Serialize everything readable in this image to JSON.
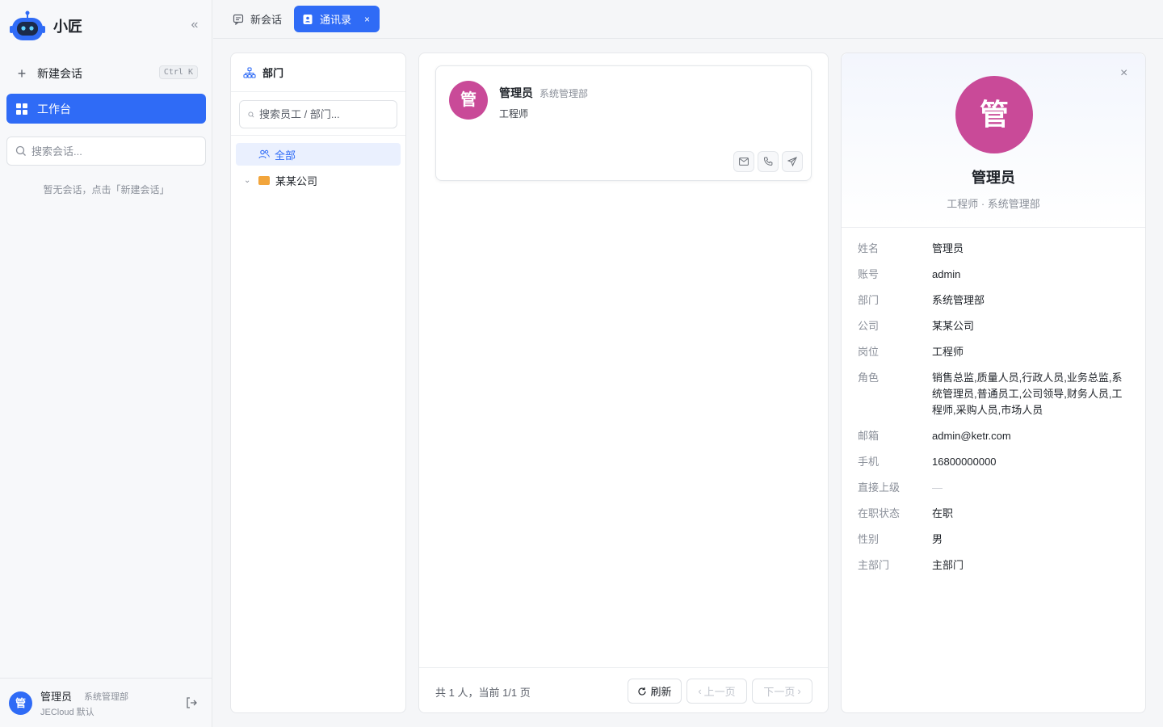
{
  "sidebar": {
    "brand": "小匠",
    "new_chat_label": "新建会话",
    "new_chat_shortcut": "Ctrl K",
    "workbench_label": "工作台",
    "search_placeholder": "搜索会话...",
    "empty_tip": "暂无会话，点击「新建会话」",
    "user": {
      "avatar": "管",
      "name": "管理员",
      "dept": "系统管理部",
      "tenant": "JECloud 默认"
    }
  },
  "tabs": [
    {
      "label": "新会话"
    },
    {
      "label": "通讯录",
      "close": "×"
    }
  ],
  "dept_panel": {
    "title": "部门",
    "search_placeholder": "搜索员工 / 部门...",
    "tree": {
      "all": "全部",
      "company": "某某公司"
    }
  },
  "list": {
    "card": {
      "avatar": "管",
      "name": "管理员",
      "dept": "系统管理部",
      "title": "工程师"
    },
    "footer": {
      "info": "共 1 人，当前 1/1 页",
      "refresh": "刷新",
      "prev": "上一页",
      "next": "下一页"
    }
  },
  "detail": {
    "avatar": "管",
    "name": "管理员",
    "subtitle": "工程师 · 系统管理部",
    "fields": [
      {
        "k": "姓名",
        "v": "管理员"
      },
      {
        "k": "账号",
        "v": "admin"
      },
      {
        "k": "部门",
        "v": "系统管理部"
      },
      {
        "k": "公司",
        "v": "某某公司"
      },
      {
        "k": "岗位",
        "v": "工程师"
      },
      {
        "k": "角色",
        "v": "销售总监,质量人员,行政人员,业务总监,系统管理员,普通员工,公司领导,财务人员,工程师,采购人员,市场人员"
      },
      {
        "k": "邮箱",
        "v": "admin@ketr.com"
      },
      {
        "k": "手机",
        "v": "16800000000"
      },
      {
        "k": "直接上级",
        "v": "—"
      },
      {
        "k": "在职状态",
        "v": "在职"
      },
      {
        "k": "性别",
        "v": "男"
      },
      {
        "k": "主部门",
        "v": "主部门"
      }
    ]
  },
  "colors": {
    "primary": "#2f6bf6",
    "avatar": "#c94a98"
  }
}
